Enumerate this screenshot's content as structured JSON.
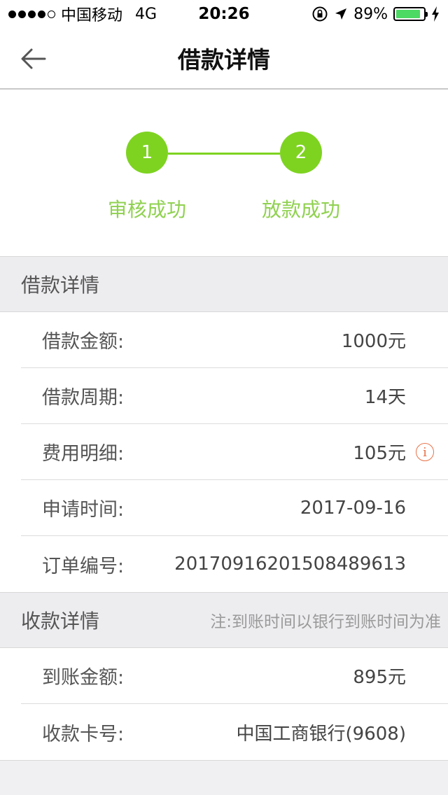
{
  "status_bar": {
    "carrier": "中国移动",
    "network": "4G",
    "time": "20:26",
    "battery": "89%",
    "battery_level": 0.89,
    "battery_color": "#4cd964"
  },
  "nav": {
    "title": "借款详情",
    "back_icon": "arrow-left-icon"
  },
  "steps": [
    {
      "number": "1",
      "label": "审核成功"
    },
    {
      "number": "2",
      "label": "放款成功"
    }
  ],
  "accent_color": "#7ed321",
  "loan_section": {
    "title": "借款详情",
    "rows": [
      {
        "label": "借款金额:",
        "value": "1000元"
      },
      {
        "label": "借款周期:",
        "value": "14天"
      },
      {
        "label": "费用明细:",
        "value": "105元",
        "info_icon": "i"
      },
      {
        "label": "申请时间:",
        "value": "2017-09-16"
      },
      {
        "label": "订单编号:",
        "value": "20170916201508489613"
      }
    ]
  },
  "receive_section": {
    "title": "收款详情",
    "note": "注:到账时间以银行到账时间为准",
    "rows": [
      {
        "label": "到账金额:",
        "value": "895元"
      },
      {
        "label": "收款卡号:",
        "value": "中国工商银行(9608)"
      }
    ]
  }
}
